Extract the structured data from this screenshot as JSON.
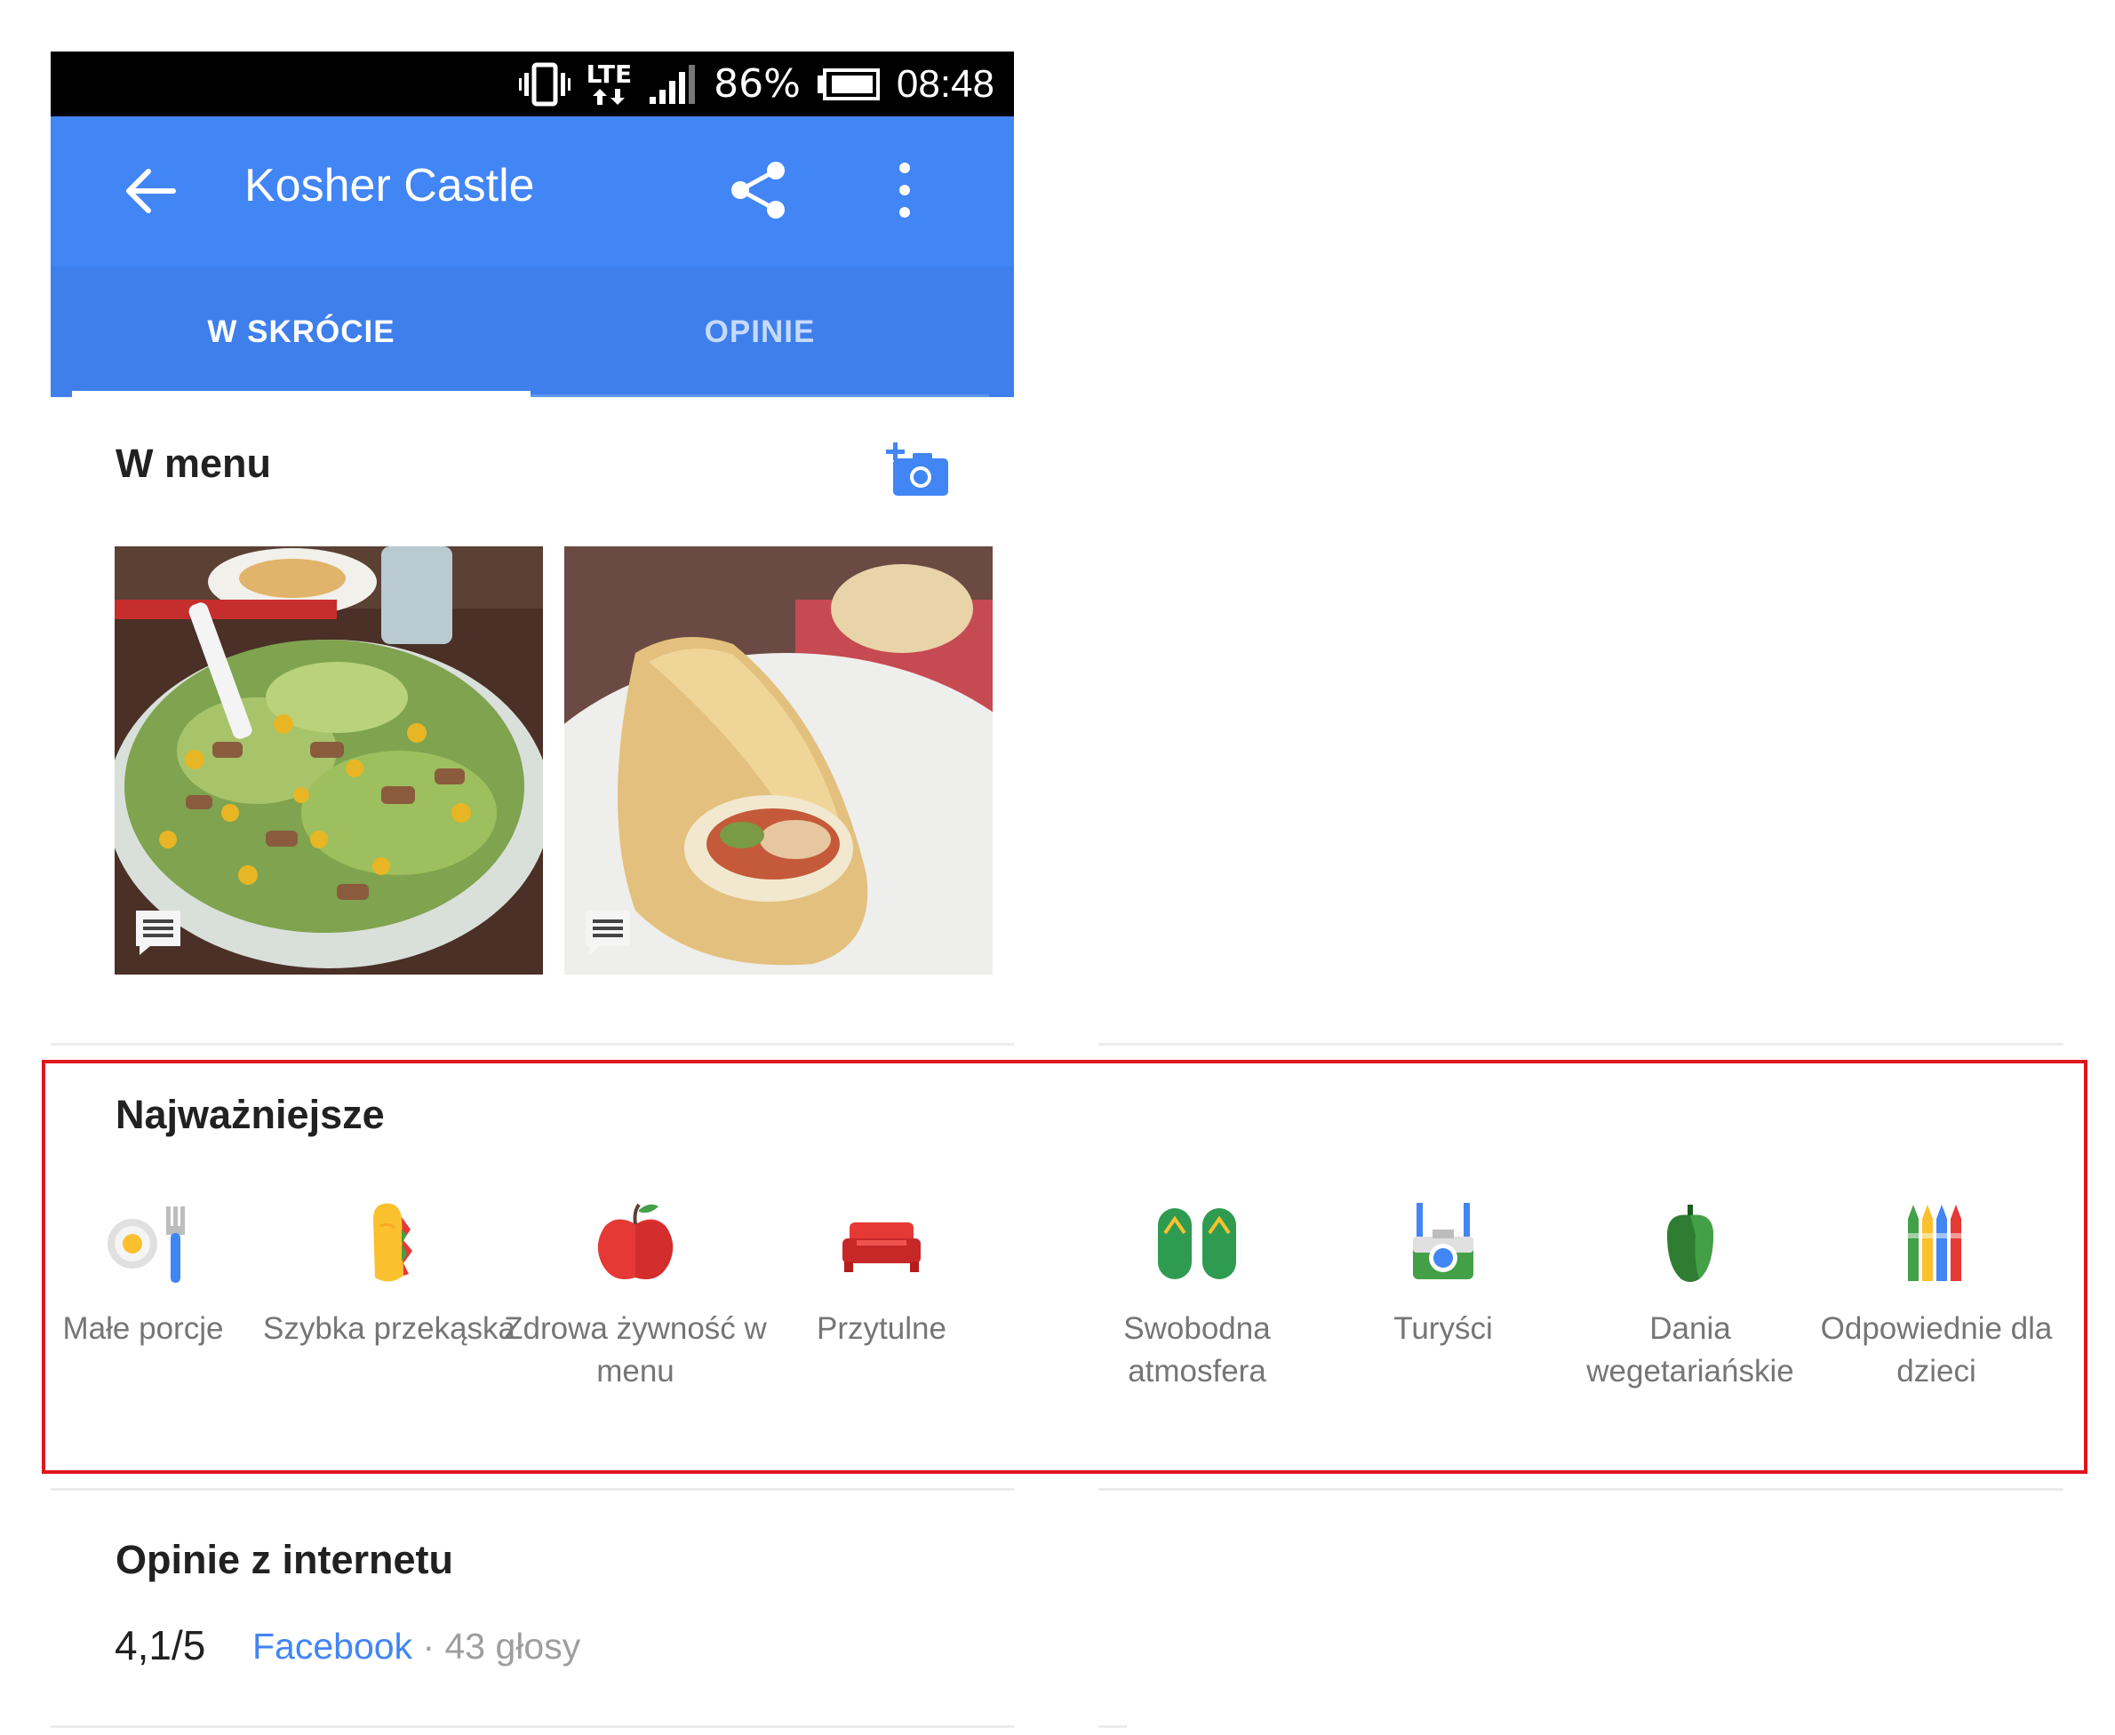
{
  "status_bar": {
    "lte": "LTE",
    "battery": "86%",
    "time": "08:48"
  },
  "app_bar": {
    "title": "Kosher Castle",
    "icons": [
      "back-arrow-icon",
      "share-icon",
      "more-vert-icon"
    ]
  },
  "tabs": [
    {
      "label": "W SKRÓCIE",
      "selected": true
    },
    {
      "label": "OPINIE",
      "selected": false
    }
  ],
  "menu_section": {
    "heading": "W menu",
    "photos": [
      "salad-photo",
      "sandwich-photo"
    ]
  },
  "highlights": {
    "heading": "Najważniejsze",
    "items": [
      {
        "label": "Małe porcje",
        "icon": "small-portions-icon"
      },
      {
        "label": "Szybka przekąska",
        "icon": "quick-bite-icon"
      },
      {
        "label": "Zdrowa żywność w menu",
        "icon": "healthy-food-icon"
      },
      {
        "label": "Przytulne",
        "icon": "cozy-icon"
      },
      {
        "label": "Swobodna atmosfera",
        "icon": "casual-icon"
      },
      {
        "label": "Turyści",
        "icon": "tourists-icon"
      },
      {
        "label": "Dania wegetariańskie",
        "icon": "vegetarian-icon"
      },
      {
        "label": "Odpowiednie dla dzieci",
        "icon": "kids-icon"
      }
    ]
  },
  "reviews": {
    "heading": "Opinie z internetu",
    "rating": "4,1/5",
    "source": "Facebook",
    "separator": " · ",
    "votes": "43 głosy"
  },
  "colors": {
    "app_bar": "#4285f4",
    "tab_bar": "#3f7fec",
    "highlight_border": "#e0161f",
    "link": "#4285f4"
  }
}
